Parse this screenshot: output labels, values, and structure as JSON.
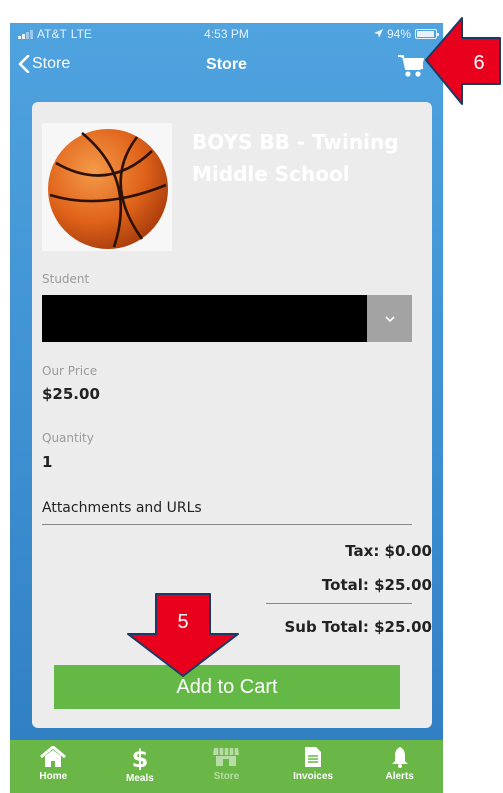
{
  "status_bar": {
    "carrier": "AT&T",
    "network": "LTE",
    "time": "4:53 PM",
    "battery": "94%",
    "battery_level": 0.94
  },
  "nav": {
    "back_label": "Store",
    "title": "Store",
    "cart_icon": "cart-icon"
  },
  "product": {
    "title": "BOYS BB - Twining Middle School",
    "image": "basketball-image",
    "student_label": "Student",
    "student_value": "",
    "price_label": "Our Price",
    "price": "$25.00",
    "quantity_label": "Quantity",
    "quantity": "1",
    "attachments_label": "Attachments and URLs"
  },
  "totals": {
    "tax": "Tax:  $0.00",
    "total": "Total:  $25.00",
    "subtotal": "Sub Total:  $25.00"
  },
  "add_to_cart_label": "Add to Cart",
  "tabs": [
    {
      "label": "Home",
      "icon": "home-icon"
    },
    {
      "label": "Meals",
      "icon": "dollar-icon"
    },
    {
      "label": "Store",
      "icon": "store-icon"
    },
    {
      "label": "Invoices",
      "icon": "document-icon"
    },
    {
      "label": "Alerts",
      "icon": "bell-icon"
    }
  ],
  "annotations": {
    "step_5": "5",
    "step_6": "6",
    "arrow_color": "#e8001c"
  }
}
